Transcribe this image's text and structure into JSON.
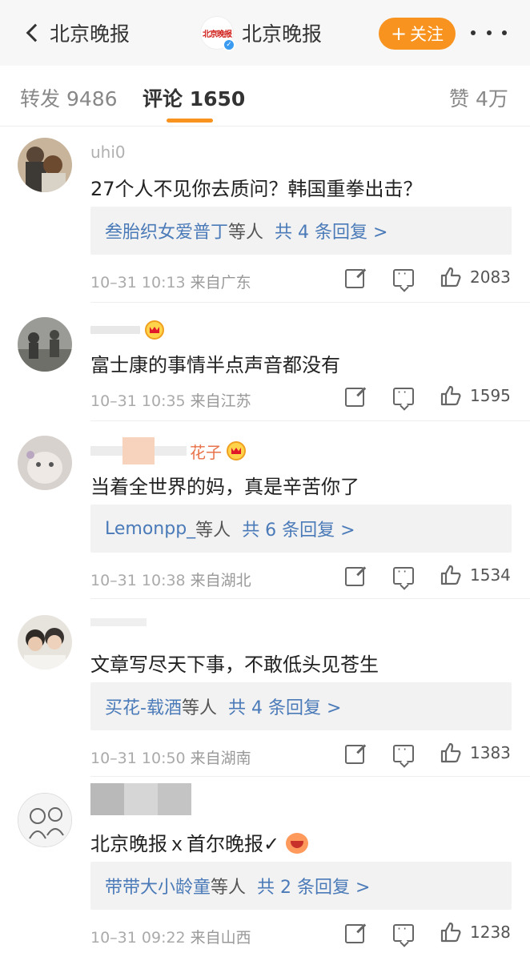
{
  "header": {
    "back_label": "北京晚报",
    "logo_text": "北京晚报",
    "account_name": "北京晚报",
    "follow_label": "关注",
    "follow_plus": "+"
  },
  "tabs": {
    "repost": "转发 9486",
    "comments": "评论 1650",
    "likes": "赞 4万"
  },
  "comments": [
    {
      "user": "uhi0",
      "text": "27个人不见你去质问？韩国重拳出击？",
      "reply_names": "叁胎织女爱普丁",
      "reply_mid": "等人",
      "reply_count": "共 4 条回复 >",
      "time": "10–31 10:13",
      "location": "来自广东",
      "likes": "2083"
    },
    {
      "user": "",
      "text": "富士康的事情半点声音都没有",
      "time": "10–31 10:35",
      "location": "来自江苏",
      "likes": "1595"
    },
    {
      "user": "花子",
      "text": "当着全世界的妈，真是辛苦你了",
      "reply_names": "Lemonpp_",
      "reply_mid": "等人",
      "reply_count": "共 6 条回复 >",
      "time": "10–31 10:38",
      "location": "来自湖北",
      "likes": "1534"
    },
    {
      "user": "",
      "text": "文章写尽天下事，不敢低头见苍生",
      "reply_names": "买花-载酒",
      "reply_mid": "等人",
      "reply_count": "共 4 条回复 >",
      "time": "10–31 10:50",
      "location": "来自湖南",
      "likes": "1383"
    },
    {
      "user": "",
      "text": "北京晚报ｘ首尔晚报✓",
      "reply_names": "带带大小龄童",
      "reply_mid": "等人",
      "reply_count": "共 2 条回复 >",
      "time": "10–31 09:22",
      "location": "来自山西",
      "likes": "1238"
    }
  ],
  "icons": {
    "share": "share-icon",
    "comment": "comment-icon",
    "like": "thumbs-up-icon",
    "crown": "crown-badge-icon"
  },
  "colors": {
    "accent": "#f7931e",
    "link": "#4a7ab8",
    "logo_red": "#d0211c"
  }
}
